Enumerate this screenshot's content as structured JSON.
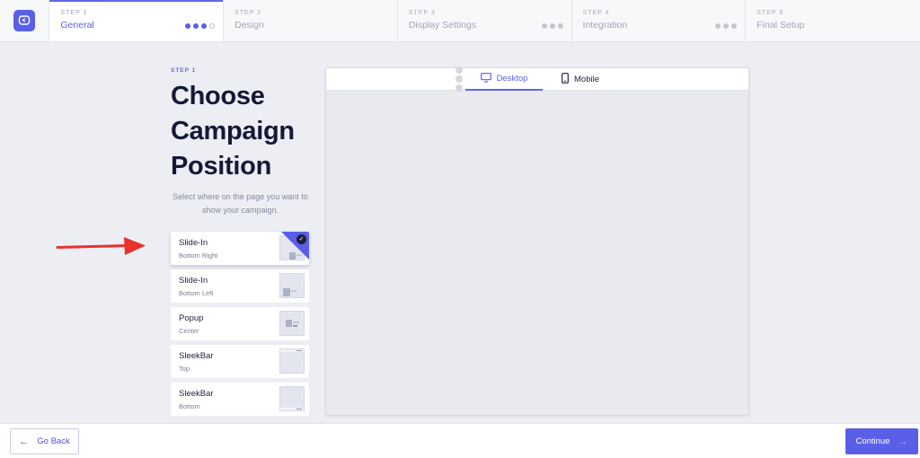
{
  "steps": [
    {
      "num": "STEP 1",
      "name": "General",
      "active": true
    },
    {
      "num": "STEP 2",
      "name": "Design"
    },
    {
      "num": "STEP 3",
      "name": "Display Settings"
    },
    {
      "num": "STEP 4",
      "name": "Integration"
    },
    {
      "num": "STEP 5",
      "name": "Final Setup"
    }
  ],
  "page": {
    "eyebrow": "STEP 1",
    "heading_lines": [
      "Choose",
      "Campaign",
      "Position"
    ],
    "subtitle": "Select where on the page you want to show your campaign."
  },
  "positions": [
    {
      "title": "Slide-In",
      "subtitle": "Bottom Right",
      "selected": true
    },
    {
      "title": "Slide-In",
      "subtitle": "Bottom Left"
    },
    {
      "title": "Popup",
      "subtitle": "Center"
    },
    {
      "title": "SleekBar",
      "subtitle": "Top"
    },
    {
      "title": "SleekBar",
      "subtitle": "Bottom"
    }
  ],
  "preview": {
    "tabs": [
      {
        "label": "Desktop",
        "icon": "desktop-icon",
        "active": true
      },
      {
        "label": "Mobile",
        "icon": "mobile-icon"
      }
    ]
  },
  "footer": {
    "back_label": "Go Back",
    "continue_label": "Continue"
  },
  "colors": {
    "accent": "#5b5fe8",
    "annotation_arrow": "#e8322b"
  }
}
